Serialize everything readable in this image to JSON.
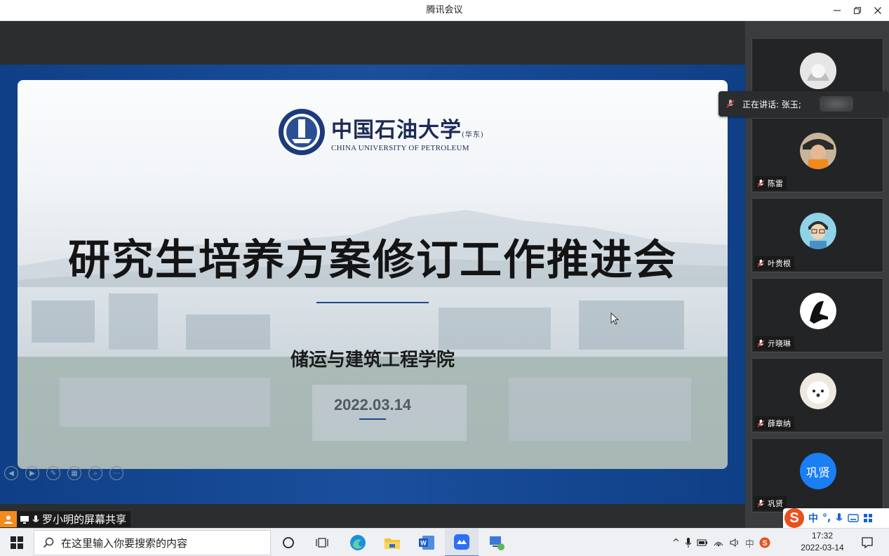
{
  "window": {
    "title": "腾讯会议"
  },
  "slide": {
    "logo_cn": "中国石油大学",
    "logo_cn_suffix": "(华东)",
    "logo_en": "CHINA UNIVERSITY OF PETROLEUM",
    "title": "研究生培养方案修订工作推进会",
    "college": "储运与建筑工程学院",
    "date": "2022.03.14"
  },
  "share_label": "罗小明的屏幕共享",
  "speaking": {
    "text": "正在讲话: 张玉;"
  },
  "participants": [
    {
      "name": "",
      "avatar": "anime-girl-avatar",
      "show_tag": false
    },
    {
      "name": "陈雷",
      "avatar": "child-avatar",
      "show_tag": true
    },
    {
      "name": "叶贵根",
      "avatar": "cartoon-man-avatar",
      "show_tag": true
    },
    {
      "name": "亓晓琳",
      "avatar": "ink-art-avatar",
      "show_tag": true
    },
    {
      "name": "薛章纳",
      "avatar": "puppy-avatar",
      "show_tag": true
    },
    {
      "name": "巩贤",
      "avatar": "text-avatar",
      "avatar_text": "巩贤",
      "avatar_color": "#1a7ef5",
      "show_tag": true
    }
  ],
  "ime": {
    "mode": "中",
    "punct": "°,"
  },
  "taskbar": {
    "search_placeholder": "在这里输入你要搜索的内容",
    "tray_input": "中",
    "time": "17:32",
    "date": "2022-03-14"
  },
  "colors": {
    "accent_blue": "#1462d8",
    "slide_frame": "#1a4f9c",
    "share_orange": "#f28a1c"
  }
}
